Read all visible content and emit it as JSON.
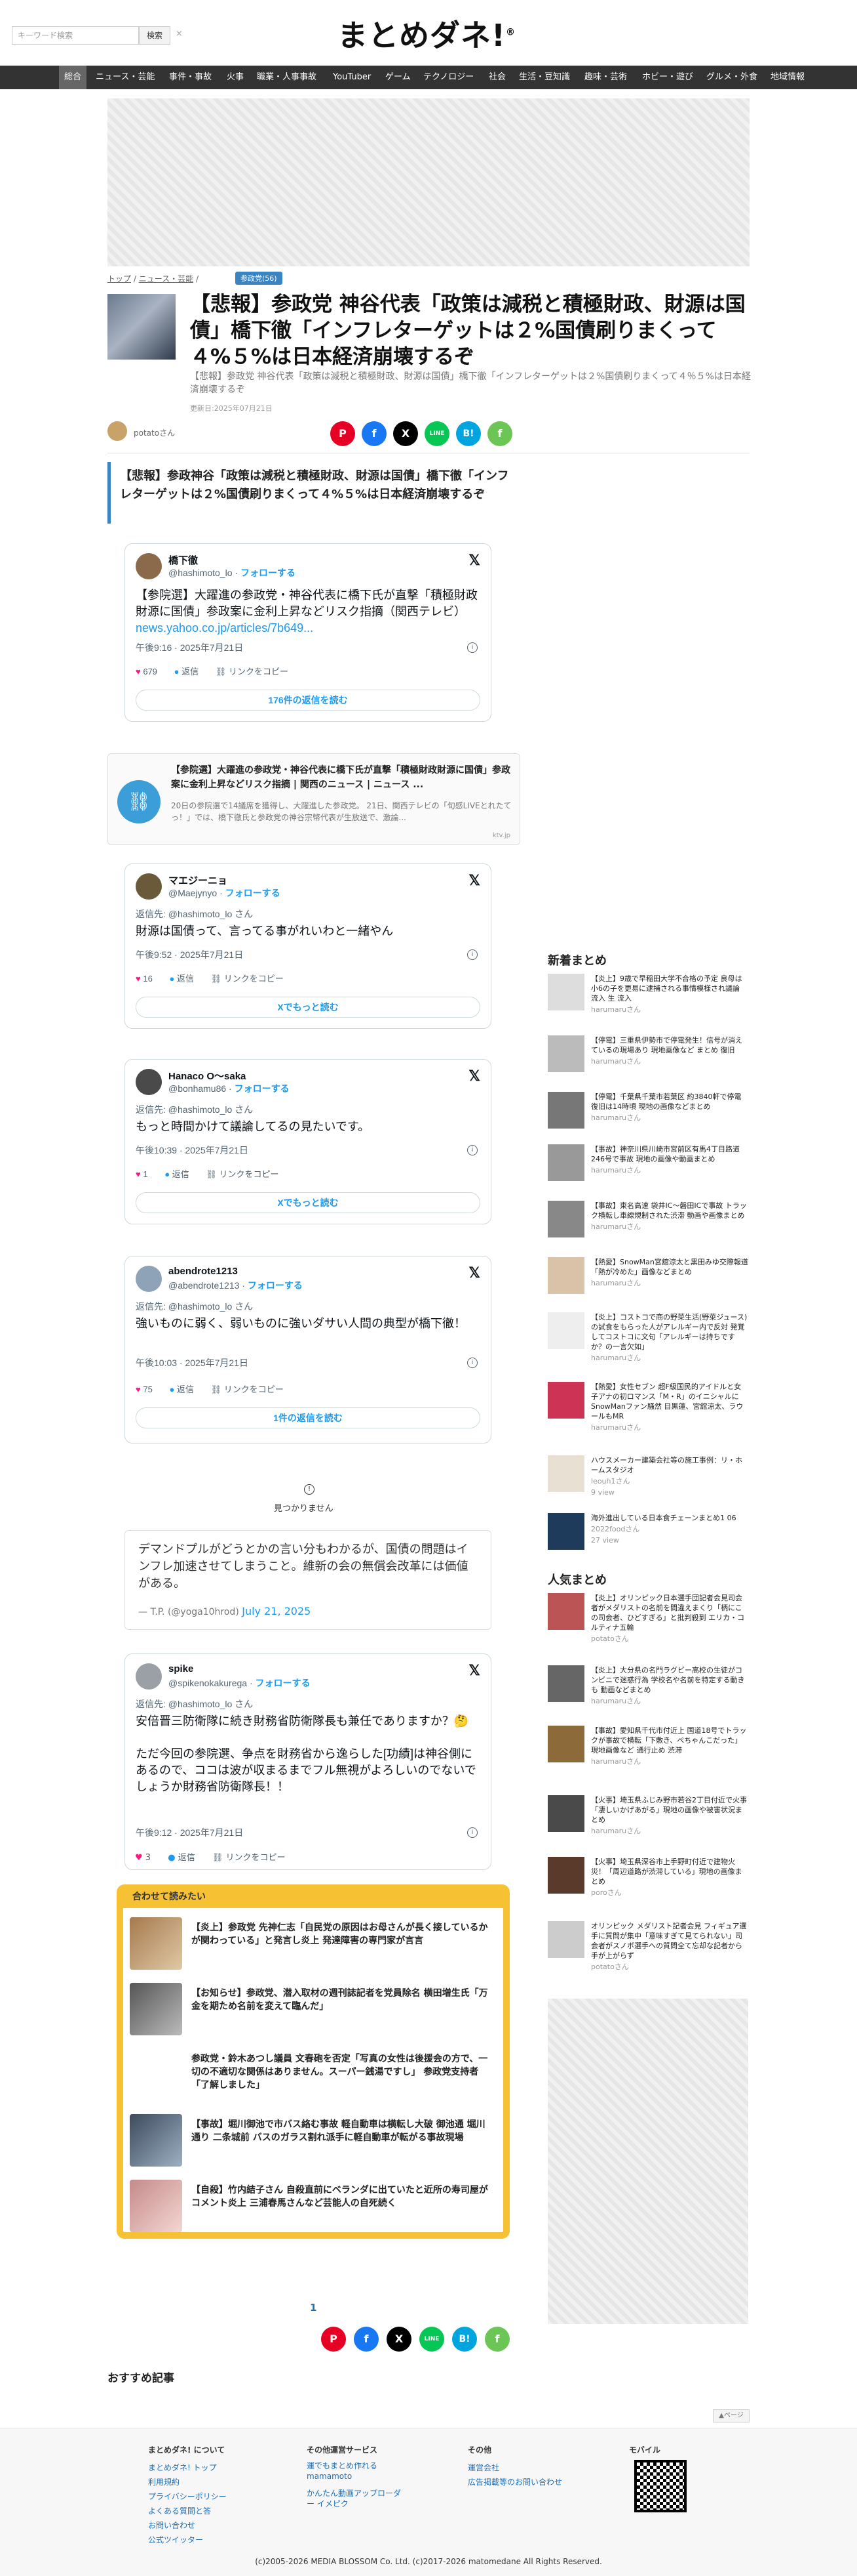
{
  "header": {
    "search_placeholder": "キーワード検索",
    "search_button": "検索",
    "search_clear": "×",
    "logo": "まとめダネ!",
    "logo_mark": "®"
  },
  "nav": [
    "総合",
    "ニュース・芸能",
    "事件・事故",
    "火事",
    "職業・人事事故",
    "YouTuber",
    "ゲーム",
    "テクノロジー",
    "社会",
    "生活・豆知識",
    "趣味・芸術",
    "ホビー・遊び",
    "グルメ・外食",
    "地域情報"
  ],
  "breadcrumb": {
    "top": "トップ",
    "sep1": "/",
    "news": "ニュース・芸能",
    "sep2": "/",
    "badge": "参政党(56)"
  },
  "article": {
    "title": "【悲報】参政党 神谷代表「政策は減税と積極財政、財源は国債」橋下徹「インフレターゲットは２%国債刷りまくって４%５%は日本経済崩壊するぞ",
    "subtitle": "【悲報】参政党 神谷代表「政策は減税と積極財政、財源は国債」橋下徹「インフレターゲットは２%国債刷りまくって４％５%は日本経済崩壊するぞ",
    "date": "更新日:2025年07月21日",
    "author": "potatoさん",
    "headline": "【悲報】参政神谷「政策は減税と積極財政、財源は国債」橋下徹「インフレターゲットは２%国債刷りまくって４%５%は日本経済崩壊するぞ"
  },
  "share": {
    "pinterest": "P",
    "facebook": "f",
    "x": "X",
    "line": "LINE",
    "hatena": "B!",
    "feedly": "f"
  },
  "tweets": [
    {
      "name": "橋下徹",
      "handle": "@hashimoto_lo",
      "follow": "フォローする",
      "text": "【参院選】大躍進の参政党・神谷代表に橋下氏が直撃「積極財政財源に国債」参政案に金利上昇などリスク指摘（関西テレビ） ",
      "link": "news.yahoo.co.jp/articles/7b649...",
      "time": "午後9:16 · 2025年7月21日",
      "likes": "679",
      "reply": "返信",
      "copy": "リンクをコピー",
      "more": "176件の返信を読む"
    },
    {
      "name": "マエジーニョ",
      "handle": "@Maejynyo",
      "follow": "フォローする",
      "reply_to": "返信先: @hashimoto_lo さん",
      "text": "財源は国債って、言ってる事がれいわと一緒やん",
      "time": "午後9:52 · 2025年7月21日",
      "likes": "16",
      "reply": "返信",
      "copy": "リンクをコピー",
      "more": "Xでもっと読む"
    },
    {
      "name": "Hanaco O〜saka",
      "handle": "@bonhamu86",
      "follow": "フォローする",
      "reply_to": "返信先: @hashimoto_lo さん",
      "text": "もっと時間かけて議論してるの見たいです。",
      "time": "午後10:39 · 2025年7月21日",
      "likes": "1",
      "reply": "返信",
      "copy": "リンクをコピー",
      "more": "Xでもっと読む"
    },
    {
      "name": "abendrote1213",
      "handle": "@abendrote1213",
      "follow": "フォローする",
      "reply_to": "返信先: @hashimoto_lo さん",
      "text": "強いものに弱く、弱いものに強いダサい人間の典型が橋下徹！",
      "time": "午後10:03 · 2025年7月21日",
      "likes": "75",
      "reply": "返信",
      "copy": "リンクをコピー",
      "more": "1件の返信を読む"
    },
    {
      "name": "spike",
      "handle": "@spikenokakurega",
      "follow": "フォローする",
      "reply_to": "返信先: @hashimoto_lo さん",
      "text": "安倍晋三防衛隊に続き財務省防衛隊長も兼任でありますか？🤔\n\nただ今回の参院選、争点を財務省から逸らした[功績]は神谷側にあるので、ココは波が収まるまでフル無視がよろしいのでないでしょうか財務省防衛隊長！！",
      "time": "午後9:12 · 2025年7月21日",
      "likes": "3",
      "reply": "返信",
      "copy": "リンクをコピー",
      "more": "Xでもっと読む"
    }
  ],
  "link_card": {
    "title": "【参院選】大躍進の参政党・神谷代表に橋下氏が直撃「積極財政財源に国債」参政案に金利上昇などリスク指摘 | 関西のニュース | ニュース ...",
    "desc": "20日の参院選で14議席を獲得し、大躍進した参政党。 21日、関西テレビの「旬感LIVEとれたてっ！」では、橋下徹氏と参政党の神谷宗幣代表が生放送で、激論...",
    "domain": "ktv.jp"
  },
  "not_found": "見つかりません",
  "quote": {
    "text": "デマンドプルがどうとかの言い分もわかるが、国債の問題はインフレ加速させてしまうこと。維新の会の無償会改革には価値がある。",
    "by": "— T.P. (@yoga10hrod)",
    "date": "July 21, 2025"
  },
  "recommend": {
    "title": "合わせて読みたい",
    "items": [
      "【炎上】参政党 先神仁志「自民党の原因はお母さんが長く接しているかが関わっている」と発言し炎上 発達障害の専門家が言言",
      "【お知らせ】参政党、潜入取材の週刊誌記者を党員除名 横田増生氏「万金を期ため名前を変えて臨んだ」",
      "参政党・鈴木あつし議員 文春砲を否定「写真の女性は後援会の方で、一切の不適切な関係はありません。スーパー銭湯ですし」 参政党支持者「了解しました」",
      "【事故】堀川御池で市バス絡む事故 軽自動車は横転し大破 御池通 堀川通り 二条城前 バスのガラス割れ派手に軽自動車が転がる事故現場",
      "【自殺】竹内結子さん 自殺直前にベランダに出ていたと近所の寿司屋がコメント炎上 三浦春馬さんなど芸能人の自死続く"
    ]
  },
  "pager": "1",
  "osusume": "おすすめ記事",
  "sidebar": {
    "new_title": "新着まとめ",
    "new_items": [
      {
        "text": "【炎上】9歳で早稲田大学不合格の予定 良母は小6の子を更易に逮捕される事情模様され議論 流入 生 流入",
        "author": "harumaruさん"
      },
      {
        "text": "【停電】三重県伊勢市で停電発生！信号が消えているの現場あり 現地画像など まとめ 復旧",
        "author": "harumaruさん"
      },
      {
        "text": "【停電】千葉県千葉市若葉区 約3840軒で停電 復旧は14時頃 現地の画像などまとめ",
        "author": "harumaruさん"
      },
      {
        "text": "【事故】神奈川県川崎市宮前区有馬4丁目路道246号で事故 現地の画像や動画まとめ",
        "author": "harumaruさん"
      },
      {
        "text": "【事故】東名高速 袋井IC〜磐田ICで事故 トラック横転し車線規制された渋滞 動画や画像まとめ",
        "author": "harumaruさん"
      },
      {
        "text": "【熱愛】SnowMan宮舘涼太と黒田みゆ交際報道「熱が冷めた」画像などまとめ",
        "author": "harumaruさん"
      },
      {
        "text": "【炎上】コストコで商の野菜生活(野菜ジュース)の試食をもらった人がアレルギー内で反対 発覚してコストコに文句「アレルギーは持ちですか？の一言欠如」",
        "author": "harumaruさん"
      },
      {
        "text": "【熱愛】女性セブン 超F級国民的アイドルと女子アナの初ロマンス「M・R」のイニシャルにSnowManファン騒然 目黒蓮、宮舘涼太、ラウールもMR",
        "author": "harumaruさん"
      },
      {
        "text": "ハウスメーカー建築会社等の施工事例：リ・ホームスタジオ",
        "author": "leouh1さん",
        "views": "9 view"
      },
      {
        "text": "海外進出している日本食チェーンまとめ1 06",
        "author": "2022foodさん",
        "views": "27 view"
      }
    ],
    "pop_title": "人気まとめ",
    "pop_items": [
      {
        "text": "【炎上】オリンピック日本選手団記者会見司会者がメダリストの名前を間違えまくり「柄にこの司会者、ひどすぎる」と批判殺到 エリカ・コルティナ五輪",
        "author": "potatoさん"
      },
      {
        "text": "【炎上】大分県の名門ラグビー高校の生徒がコンビニで迷惑行為 学校名や名前を特定する動きも 動画などまとめ",
        "author": "harumaruさん"
      },
      {
        "text": "【事故】愛知県千代市付近上 国道18号でトラックが事故で横転「下敷き、ぺちゃんこだった」現地画像など 通行止め 渋滞",
        "author": "harumaruさん"
      },
      {
        "text": "【火事】埼玉県ふじみ野市若谷2丁目付近で火事「凄しいかげあがる」現地の画像や被害状況まとめ",
        "author": "harumaruさん"
      },
      {
        "text": "【火事】埼玉県深谷市上手野町付近で建物火災！「周辺道路が渋滞している」現地の画像まとめ",
        "author": "poroさん"
      },
      {
        "text": "オリンピック メダリスト記者会見 フィギュア選手に質問が集中「意味すぎて見てられない」司会者がスノボ選手への質問全て忘却な記者から手が上がらず",
        "author": "potatoさん"
      }
    ]
  },
  "scroll_top": "▲ページ",
  "footer": {
    "col1_head": "まとめダネ! について",
    "col1": [
      "まとめダネ! トップ",
      "利用規約",
      "プライバシーポリシー",
      "よくある質問と答",
      "お問い合わせ",
      "公式ツイッター"
    ],
    "col2_head": "その他運営サービス",
    "col2": [
      "運でもまとめ作れる mamamoto",
      "かんたん動画アップローダー イメピク"
    ],
    "col3_head": "その他",
    "col3": [
      "運営会社",
      "広告掲載等のお問い合わせ"
    ],
    "col4_head": "モバイル",
    "copyright": "(c)2005-2026 MEDIA BLOSSOM Co. Ltd. (c)2017-2026 matomedane All Rights Reserved."
  },
  "colors": {
    "accent": "#3b84c4",
    "nav_bg": "#333333",
    "recommend_border": "#f6c233",
    "x_link": "#1d9bf0",
    "heart": "#f91880"
  }
}
